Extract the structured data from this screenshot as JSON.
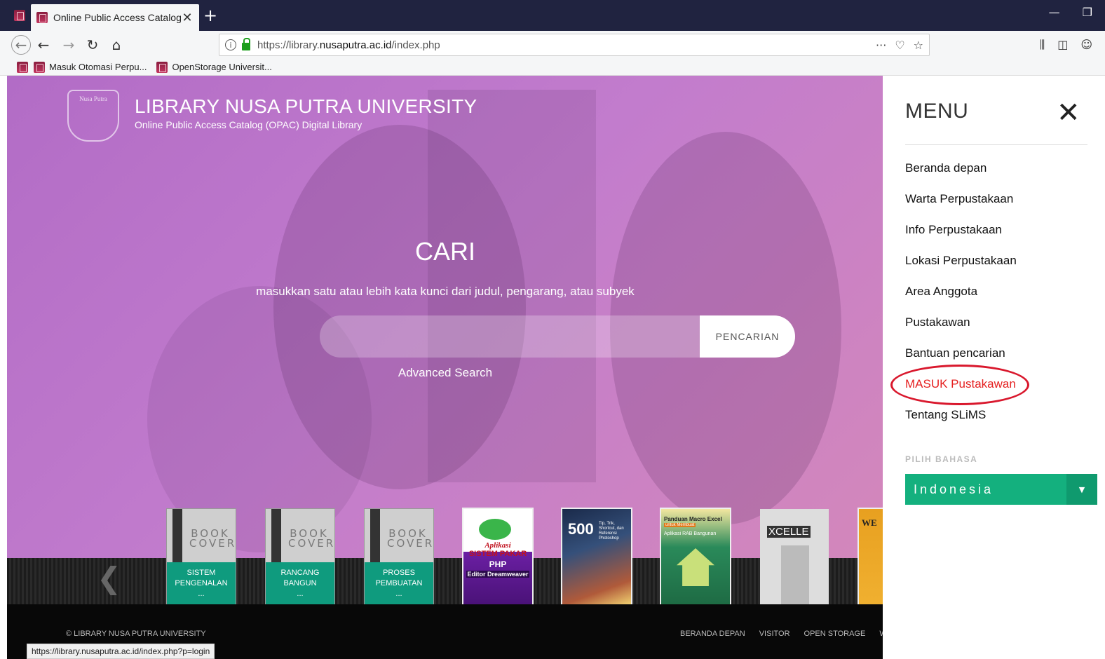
{
  "browser": {
    "tab_title": "Online Public Access Catalog (",
    "new_tab": "+",
    "url_prefix": "https://library.",
    "url_domain": "nusaputra.ac.id",
    "url_suffix": "/index.php",
    "bookmarks": [
      "Masuk Otomasi Perpu...",
      "OpenStorage Universit..."
    ],
    "status_url": "https://library.nusaputra.ac.id/index.php?p=login"
  },
  "header": {
    "logo_text": "Nusa Putra",
    "title": "LIBRARY NUSA PUTRA UNIVERSITY",
    "subtitle": "Online Public Access Catalog (OPAC) Digital Library"
  },
  "search": {
    "title": "CARI",
    "hint": "masukkan satu atau lebih kata kunci dari judul, pengarang, atau subyek",
    "placeholder": "",
    "button": "PENCARIAN",
    "advanced": "Advanced Search"
  },
  "books": [
    {
      "cover_word1": "BOOK",
      "cover_word2": "COVER",
      "line1": "SISTEM",
      "line2": "PENGENALAN",
      "line3": "..."
    },
    {
      "cover_word1": "BOOK",
      "cover_word2": "COVER",
      "line1": "RANCANG",
      "line2": "BANGUN",
      "line3": "..."
    },
    {
      "cover_word1": "BOOK",
      "cover_word2": "COVER",
      "line1": "PROSES",
      "line2": "PEMBUATAN",
      "line3": "..."
    }
  ],
  "cover_texts": {
    "c4_line1": "Aplikasi",
    "c4_line2": "SISTEM PAKAR",
    "c4_line3": "PHP",
    "c4_line4": "Editor Dreamweaver",
    "c5_num": "500",
    "c5_text": "Tip, Trik, Shortcut, dan Referensi Photoshop",
    "c6_line1": "Panduan Macro Excel",
    "c6_line2": "untuk Membuat",
    "c6_line3": "Aplikasi RAB Bangunan",
    "c7_text": "XCELLE",
    "c8_text": "WE"
  },
  "footer": {
    "copyright": "© LIBRARY NUSA PUTRA UNIVERSITY",
    "links": [
      "BERANDA DEPAN",
      "VISITOR",
      "OPEN STORAGE",
      "W"
    ]
  },
  "menu": {
    "title": "MENU",
    "items": [
      "Beranda depan",
      "Warta Perpustakaan",
      "Info Perpustakaan",
      "Lokasi Perpustakaan",
      "Area Anggota",
      "Pustakawan",
      "Bantuan pencarian",
      "MASUK Pustakawan",
      "Tentang SLiMS"
    ],
    "lang_label": "PILIH BAHASA",
    "lang_value": "Indonesia"
  },
  "colors": {
    "titlebar": "#202340",
    "menu_active": "#e52121",
    "lang_select": "#14b07e",
    "annotation_circle": "#d9182d"
  }
}
